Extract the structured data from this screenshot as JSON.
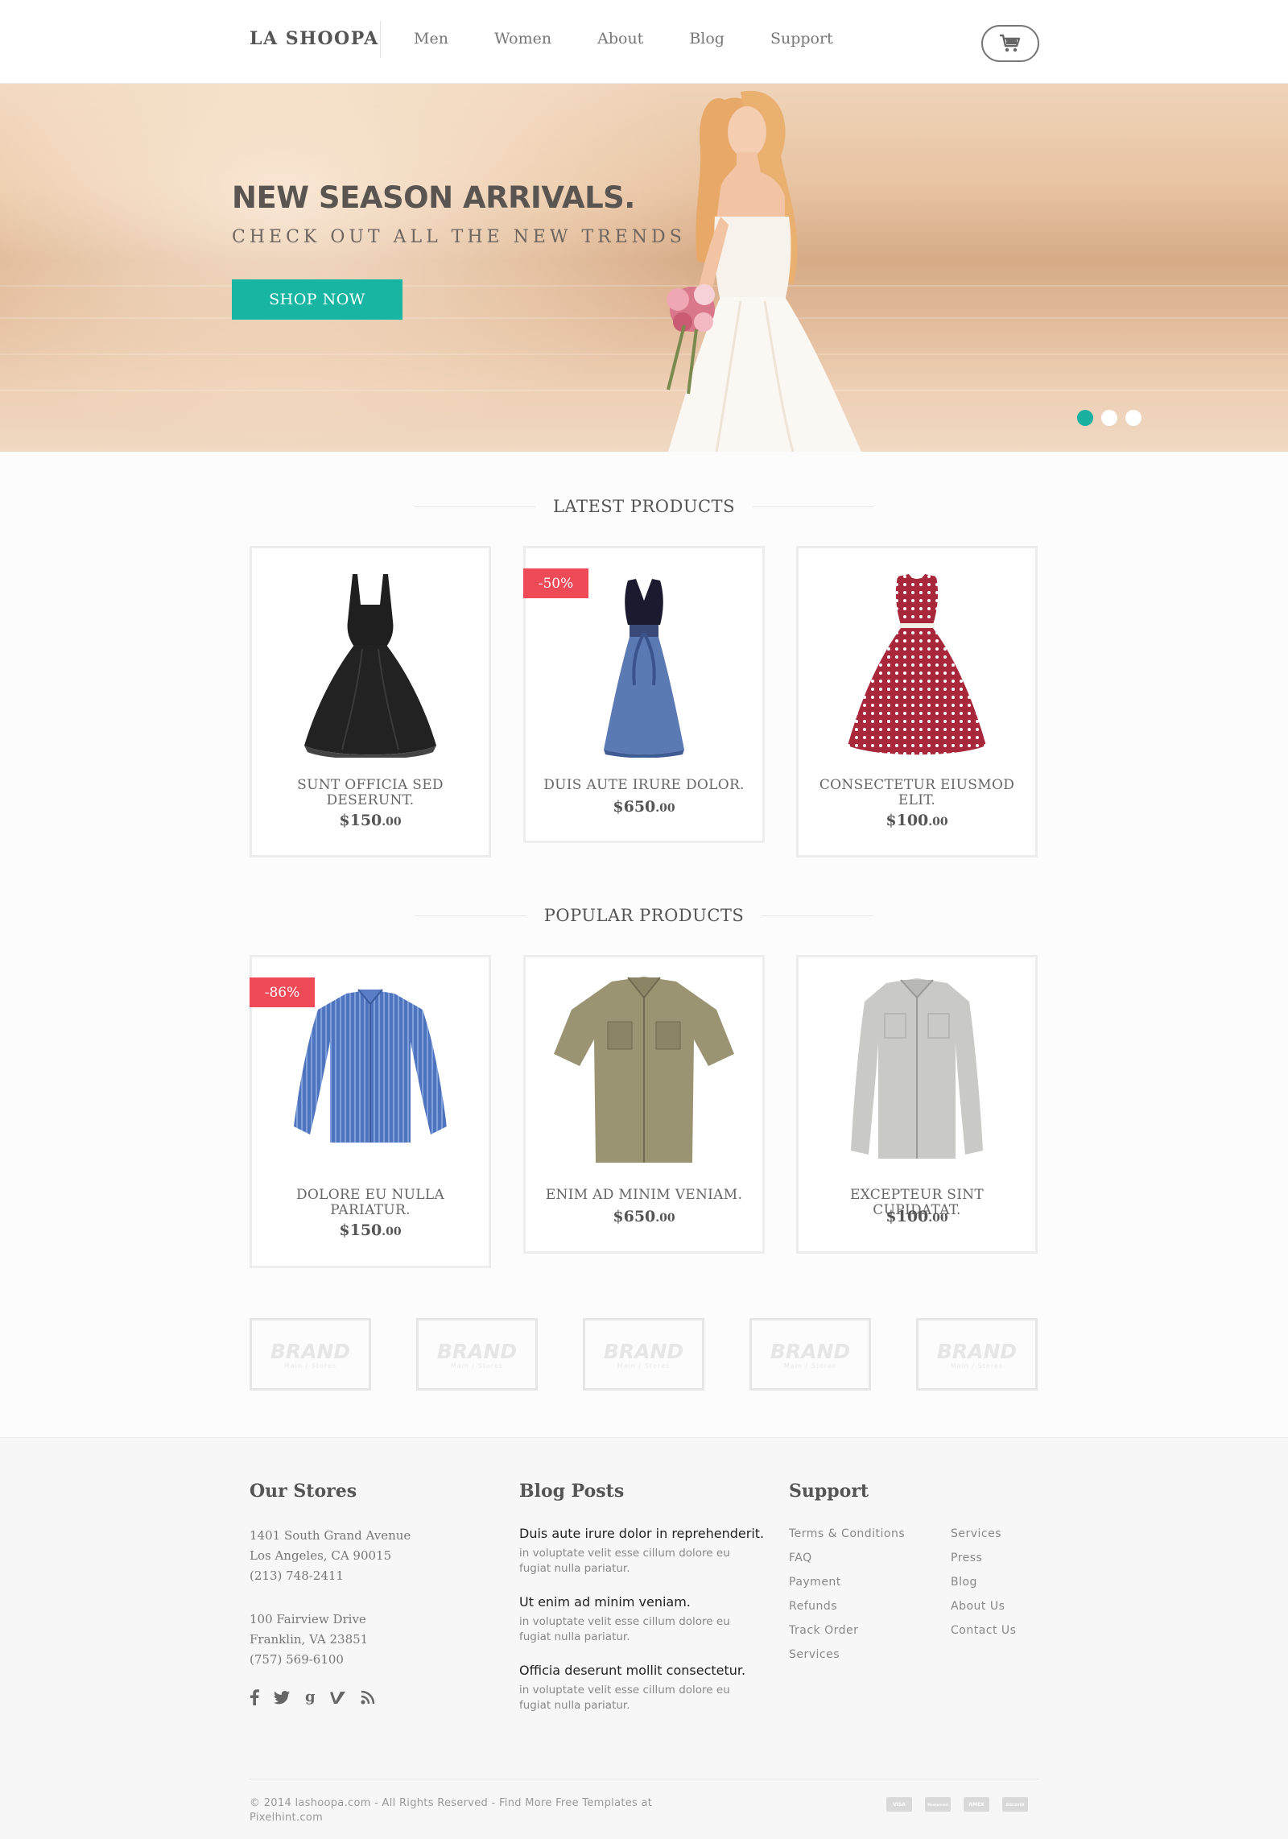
{
  "brand": {
    "logo": "LA SHOOPA"
  },
  "nav": {
    "items": [
      {
        "label": "Men"
      },
      {
        "label": "Women"
      },
      {
        "label": "About"
      },
      {
        "label": "Blog"
      },
      {
        "label": "Support"
      }
    ]
  },
  "hero": {
    "title": "NEW SEASON ARRIVALS.",
    "subtitle": "CHECK OUT ALL THE NEW TRENDS",
    "cta": "SHOP NOW",
    "slides": 3,
    "active_slide": 1,
    "accent": "#18b5a3"
  },
  "latest": {
    "title": "LATEST PRODUCTS",
    "products": [
      {
        "name": "SUNT OFFICIA SED DESERUNT.",
        "price": "$150",
        "cents": ".00",
        "badge": "",
        "icon": "black-dress"
      },
      {
        "name": "DUIS AUTE IRURE DOLOR.",
        "price": "$650",
        "cents": ".00",
        "badge": "-50%",
        "icon": "blue-dress"
      },
      {
        "name": "CONSECTETUR EIUSMOD ELIT.",
        "price": "$100",
        "cents": ".00",
        "badge": "",
        "icon": "red-polka-dress"
      }
    ]
  },
  "popular": {
    "title": "POPULAR PRODUCTS",
    "products": [
      {
        "name": "DOLORE EU NULLA PARIATUR.",
        "price": "$150",
        "cents": ".00",
        "badge": "-86%",
        "icon": "blue-striped-shirt"
      },
      {
        "name": "ENIM AD MINIM VENIAM.",
        "price": "$650",
        "cents": ".00",
        "badge": "",
        "icon": "khaki-shirt"
      },
      {
        "name": "EXCEPTEUR SINT CUPIDATAT.",
        "price": "$100",
        "cents": ".00",
        "badge": "",
        "icon": "grey-shirt"
      }
    ]
  },
  "brands": [
    {
      "name": "BRAND",
      "sub": "Main / Stores"
    },
    {
      "name": "BRAND",
      "sub": "Main / Stores"
    },
    {
      "name": "BRAND",
      "sub": "Main / Stores"
    },
    {
      "name": "BRAND",
      "sub": "Main / Stores"
    },
    {
      "name": "BRAND",
      "sub": "Main / Stores"
    }
  ],
  "footer": {
    "stores": {
      "title": "Our Stores",
      "store1": [
        "1401 South Grand Avenue",
        "Los Angeles, CA 90015",
        "(213) 748-2411"
      ],
      "store2": [
        "100 Fairview Drive",
        "Franklin, VA 23851",
        "(757) 569-6100"
      ],
      "social": [
        "facebook-icon",
        "twitter-icon",
        "google-plus-icon",
        "vimeo-icon",
        "rss-icon"
      ]
    },
    "blog": {
      "title": "Blog Posts",
      "posts": [
        {
          "title": "Duis aute irure dolor in reprehenderit.",
          "text": "in voluptate velit esse cillum dolore eu fugiat nulla pariatur."
        },
        {
          "title": "Ut enim ad minim veniam.",
          "text": "in voluptate velit esse cillum dolore eu fugiat nulla pariatur."
        },
        {
          "title": "Officia deserunt mollit consectetur.",
          "text": "in voluptate velit esse cillum dolore eu fugiat nulla pariatur."
        }
      ]
    },
    "support": {
      "title": "Support",
      "col1": [
        "Terms & Conditions",
        "FAQ",
        "Payment",
        "Refunds",
        "Track Order",
        "Services"
      ],
      "col2": [
        "Services",
        "Press",
        "Blog",
        "About Us",
        "Contact Us"
      ]
    },
    "copyright": "© 2014 lashoopa.com - All Rights Reserved - Find More Free Templates at Pixelhint.com",
    "payments": [
      "VISA",
      "Mastercard",
      "AMEX",
      "DISCOVER"
    ]
  },
  "colors": {
    "accent": "#18b5a3",
    "badge": "#ee4a57"
  }
}
